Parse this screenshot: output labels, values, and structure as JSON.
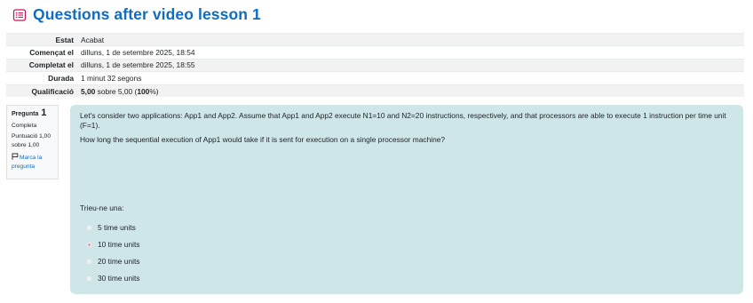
{
  "page": {
    "title": "Questions after video lesson 1",
    "icon": "quiz-icon",
    "accent_color": "#0f6cbf",
    "icon_color": "#c2185b"
  },
  "summary": [
    {
      "label": "Estat",
      "value": "Acabat"
    },
    {
      "label": "Començat el",
      "value": "dilluns, 1 de setembre 2025, 18:54"
    },
    {
      "label": "Completat el",
      "value": "dilluns, 1 de setembre 2025, 18:55"
    },
    {
      "label": "Durada",
      "value": "1 minut 32 segons"
    },
    {
      "label": "Qualificació",
      "value_bold": "5,00",
      "value_mid": " sobre 5,00 (",
      "value_pct": "100",
      "value_end": "%)"
    }
  ],
  "question_info": {
    "label": "Pregunta",
    "number": "1",
    "state": "Completa",
    "score": "Puntuació 1,00 sobre 1,00",
    "flag_label": "Marca la pregunta",
    "flag_icon": "flag-icon"
  },
  "question": {
    "text": "Let's consider two applications: App1 and App2. Assume that App1 and App2 execute N1=10 and N2=20 instructions, respectively, and that processors are able to execute 1 instruction per time unit (F=1).",
    "text2": "How long the sequential execution of App1 would take if it is sent for execution on a single processor machine?",
    "prompt": "Trieu-ne una:",
    "options": [
      {
        "label": "5 time units",
        "selected": false
      },
      {
        "label": "10 time units",
        "selected": true
      },
      {
        "label": "20 time units",
        "selected": false
      },
      {
        "label": "30 time units",
        "selected": false
      }
    ],
    "background": "#cfe6e9"
  }
}
